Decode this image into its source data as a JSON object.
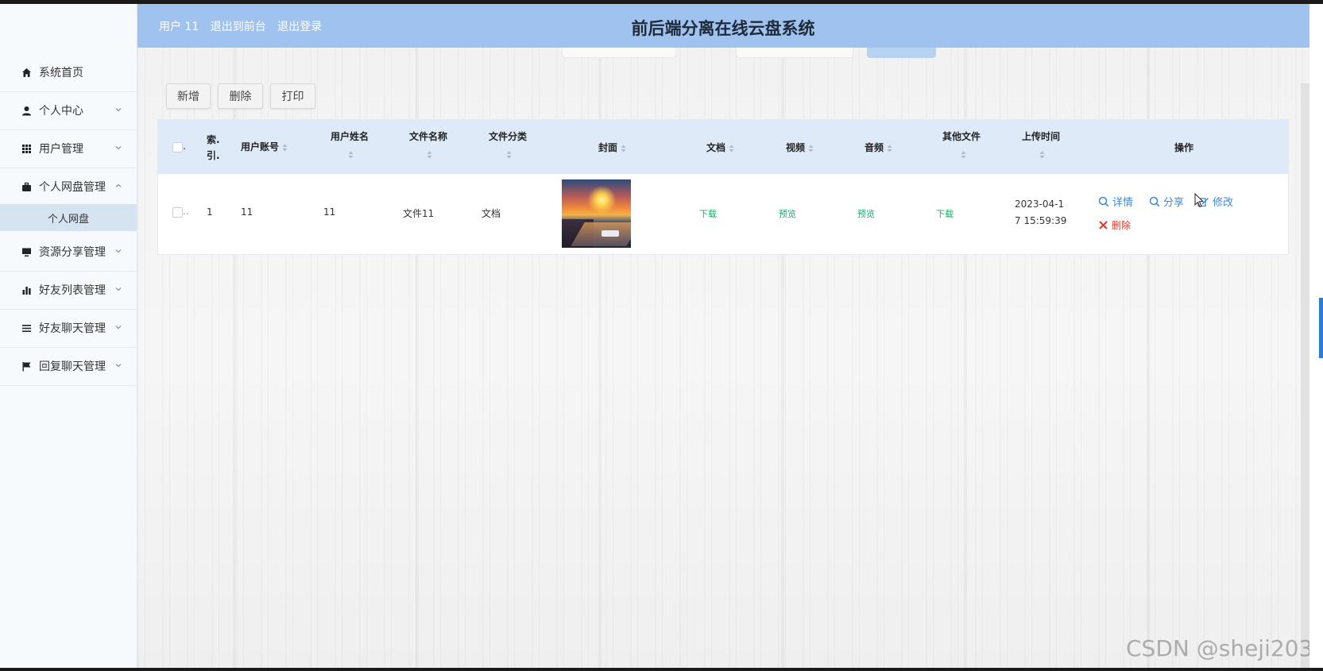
{
  "header": {
    "user_label": "用户 11",
    "front_link": "退出到前台",
    "logout_link": "退出登录",
    "title": "前后端分离在线云盘系统"
  },
  "sidebar": {
    "items": [
      {
        "label": "系统首页",
        "icon": "home-icon"
      },
      {
        "label": "个人中心",
        "icon": "user-icon",
        "chevron": "down"
      },
      {
        "label": "用户管理",
        "icon": "grid-icon",
        "chevron": "down"
      },
      {
        "label": "个人网盘管理",
        "icon": "briefcase-icon",
        "chevron": "up"
      },
      {
        "label": "资源分享管理",
        "icon": "monitor-icon",
        "chevron": "down"
      },
      {
        "label": "好友列表管理",
        "icon": "bar-chart-icon",
        "chevron": "down"
      },
      {
        "label": "好友聊天管理",
        "icon": "list-icon",
        "chevron": "down"
      },
      {
        "label": "回复聊天管理",
        "icon": "flag-icon",
        "chevron": "down"
      }
    ],
    "sub_item": "个人网盘"
  },
  "toolbar": {
    "add_label": "新增",
    "delete_label": "删除",
    "print_label": "打印"
  },
  "table": {
    "columns": {
      "index": "索引",
      "index_top": "索.",
      "index_bottom": "引.",
      "account": "用户账号",
      "name": "用户姓名",
      "filename": "文件名称",
      "category": "文件分类",
      "cover": "封面",
      "doc": "文档",
      "video": "视频",
      "audio": "音频",
      "other": "其他文件",
      "upload_time": "上传时间",
      "actions": "操作"
    },
    "rows": [
      {
        "index": "1",
        "account": "11",
        "name": "11",
        "filename": "文件11",
        "category": "文档",
        "doc": "下载",
        "video": "预览",
        "audio": "预览",
        "other": "下载",
        "upload_time_line1": "2023-04-1",
        "upload_time_line2": "7 15:59:39",
        "actions": {
          "detail": "详情",
          "share": "分享",
          "edit": "修改",
          "delete": "删除"
        }
      }
    ]
  },
  "watermark": "CSDN @sheji203",
  "colors": {
    "header": "#9fc3ee",
    "table_header": "#deeaf8",
    "link_blue": "#3c8ad8",
    "link_green": "#2aa36b",
    "delete_red": "#d23b2e"
  }
}
